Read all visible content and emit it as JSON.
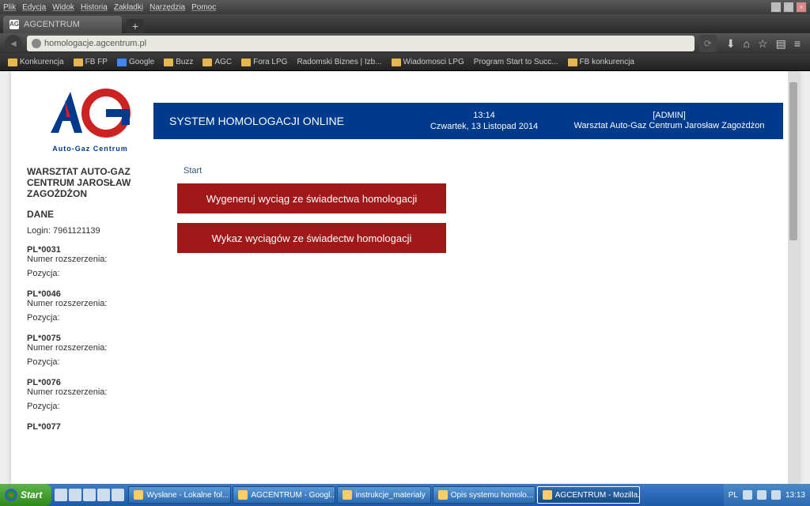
{
  "menu": [
    "Plik",
    "Edycja",
    "Widok",
    "Historia",
    "Zakładki",
    "Narzędzia",
    "Pomoc"
  ],
  "tab": {
    "title": "AGCENTRUM",
    "icon": "AG"
  },
  "url": "homologacje.agcentrum.pl",
  "bookmarks": [
    {
      "t": "folder",
      "label": "Konkurencja"
    },
    {
      "t": "folder",
      "label": "FB FP"
    },
    {
      "t": "icon",
      "label": "Google"
    },
    {
      "t": "folder",
      "label": "Buzz"
    },
    {
      "t": "folder",
      "label": "AGC"
    },
    {
      "t": "folder",
      "label": "Fora LPG"
    },
    {
      "t": "page",
      "label": "Radomski Biznes | Izb..."
    },
    {
      "t": "folder",
      "label": "Wiadomosci LPG"
    },
    {
      "t": "page",
      "label": "Program Start to Succ..."
    },
    {
      "t": "folder",
      "label": "FB konkurencja"
    }
  ],
  "logo_sub": "Auto-Gaz Centrum",
  "banner": {
    "title": "SYSTEM HOMOLOGACJI ONLINE",
    "time": "13:14",
    "date": "Czwartek, 13 Listopad 2014",
    "role": "[ADMIN]",
    "user": "Warsztat Auto-Gaz Centrum Jarosław Zagożdżon"
  },
  "sidebar": {
    "title": "WARSZTAT AUTO-GAZ CENTRUM JAROSŁAW ZAGOŻDŻON",
    "dane": "DANE",
    "login": "Login: 7961121139",
    "items": [
      {
        "code": "PL*0031",
        "ext": "Numer rozszerzenia:",
        "pos": "Pozycja:"
      },
      {
        "code": "PL*0046",
        "ext": "Numer rozszerzenia:",
        "pos": "Pozycja:"
      },
      {
        "code": "PL*0075",
        "ext": "Numer rozszerzenia:",
        "pos": "Pozycja:"
      },
      {
        "code": "PL*0076",
        "ext": "Numer rozszerzenia:",
        "pos": "Pozycja:"
      },
      {
        "code": "PL*0077",
        "ext": "",
        "pos": ""
      }
    ]
  },
  "main": {
    "breadcrumb": "Start",
    "btn1": "Wygeneruj wyciąg ze świadectwa homologacji",
    "btn2": "Wykaz wyciągów ze świadectw homologacji"
  },
  "taskbar": {
    "start": "Start",
    "tasks": [
      "Wysłane - Lokalne fol...",
      "AGCENTRUM - Googl...",
      "instrukcje_materialy",
      "Opis systemu homolo...",
      "AGCENTRUM - Mozilla..."
    ],
    "tray": {
      "lang": "PL",
      "time": "13:13"
    }
  }
}
